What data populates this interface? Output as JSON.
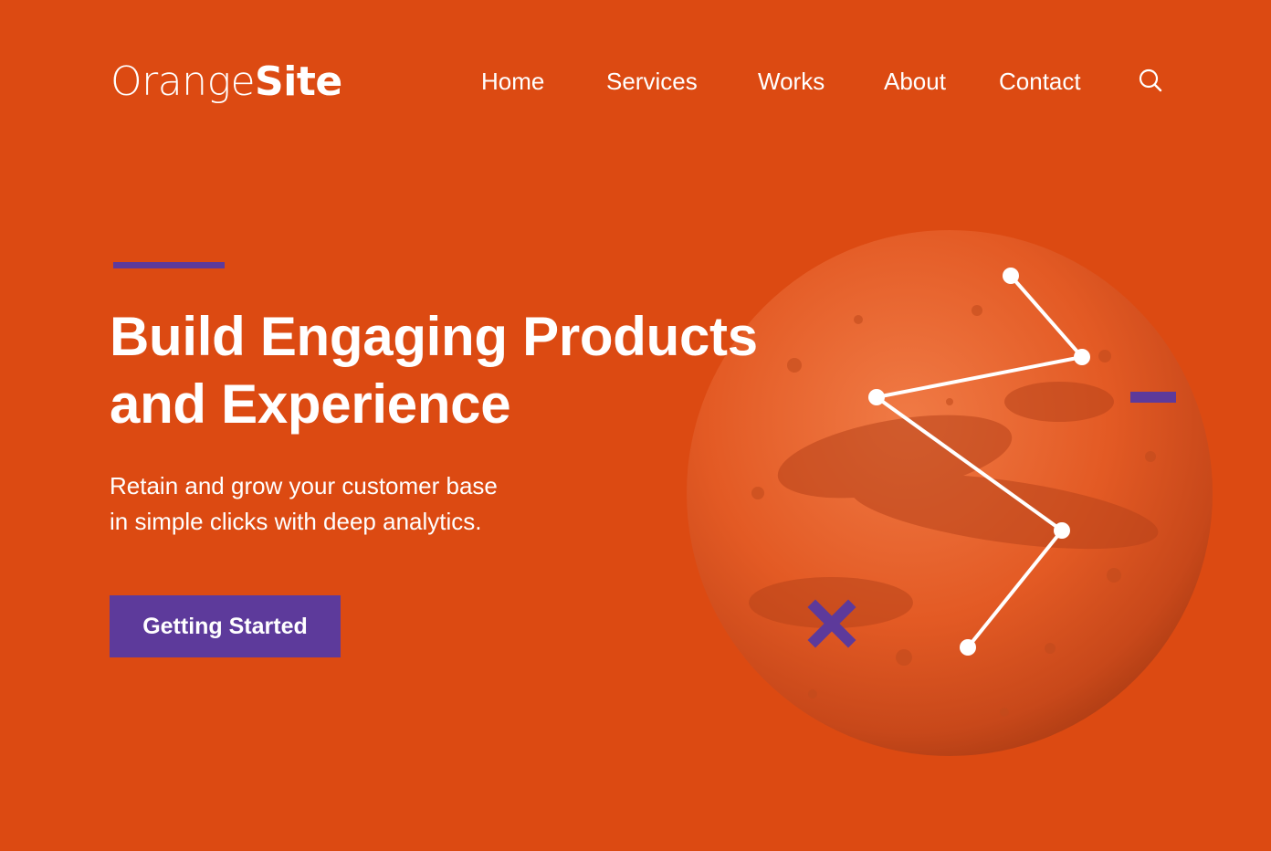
{
  "header": {
    "logo": {
      "light": "Orange",
      "bold": "Site"
    },
    "nav": [
      {
        "label": "Home"
      },
      {
        "label": "Services"
      },
      {
        "label": "Works"
      },
      {
        "label": "About"
      },
      {
        "label": "Contact"
      }
    ],
    "search_icon": "search-icon"
  },
  "hero": {
    "title_line1": "Build Engaging Products",
    "title_line2": "and Experience",
    "subtitle_line1": "Retain and grow your customer base",
    "subtitle_line2": "in simple clicks with deep analytics.",
    "cta_label": "Getting Started"
  },
  "illustration": {
    "planet": "mars-planet-image",
    "constellation": "constellation-line",
    "decorations": [
      "close-x-icon",
      "dash-shape"
    ]
  },
  "colors": {
    "background": "#dc4a12",
    "accent": "#5d3a9b",
    "text": "#ffffff",
    "planet": "#e45a24"
  }
}
